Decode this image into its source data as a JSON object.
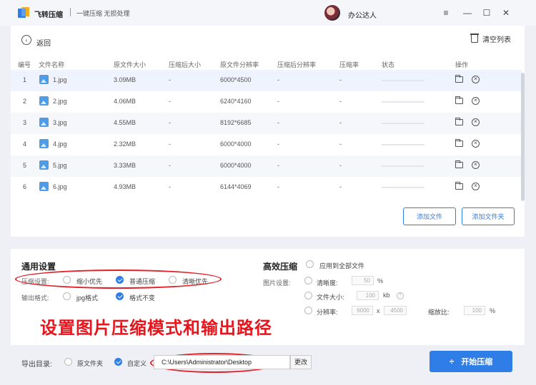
{
  "app": {
    "title": "飞转压缩",
    "subtitle": "一键压缩 无损处理",
    "username": "办公达人",
    "window_controls": [
      "minimize-icon",
      "maximize-icon",
      "close-icon"
    ],
    "accent_color": "#2f7ee8",
    "icon_menu": "≡",
    "icon_min": "—",
    "icon_max": "☐",
    "icon_close": "✕"
  },
  "toolbar": {
    "back_label": "返回",
    "back_icon": "‹",
    "clear_label": "清空列表"
  },
  "table": {
    "headers": [
      "编号",
      "文件名称",
      "原文件大小",
      "压缩后大小",
      "原文件分辨率",
      "压缩后分辨率",
      "压缩率",
      "状态",
      "操作"
    ],
    "rows": [
      {
        "index": "1",
        "name": "1.jpg",
        "size": "3.09MB",
        "compressed_size": "-",
        "resolution": "6000*4500",
        "compressed_resolution": "-",
        "ratio": "-",
        "delete_icon": "×"
      },
      {
        "index": "2",
        "name": "2.jpg",
        "size": "4.06MB",
        "compressed_size": "-",
        "resolution": "6240*4160",
        "compressed_resolution": "-",
        "ratio": "-",
        "delete_icon": "×"
      },
      {
        "index": "3",
        "name": "3.jpg",
        "size": "4.55MB",
        "compressed_size": "-",
        "resolution": "8192*6685",
        "compressed_resolution": "-",
        "ratio": "-",
        "delete_icon": "×"
      },
      {
        "index": "4",
        "name": "4.jpg",
        "size": "2.32MB",
        "compressed_size": "-",
        "resolution": "6000*4000",
        "compressed_resolution": "-",
        "ratio": "-",
        "delete_icon": "×"
      },
      {
        "index": "5",
        "name": "5.jpg",
        "size": "3.33MB",
        "compressed_size": "-",
        "resolution": "6000*4000",
        "compressed_resolution": "-",
        "ratio": "-",
        "delete_icon": "×"
      },
      {
        "index": "6",
        "name": "6.jpg",
        "size": "4.93MB",
        "compressed_size": "-",
        "resolution": "6144*4069",
        "compressed_resolution": "-",
        "ratio": "-",
        "delete_icon": "×"
      }
    ]
  },
  "actions": {
    "add_file": "添加文件",
    "add_folder": "添加文件夹"
  },
  "general_settings": {
    "title": "通用设置",
    "compress_label": "压缩设置:",
    "compress_options": [
      "缩小优先",
      "普通压缩",
      "清晰优先"
    ],
    "compress_selected": "普通压缩",
    "output_label": "输出格式:",
    "output_options": [
      "jpg格式",
      "格式不变"
    ],
    "output_selected": "格式不变"
  },
  "advanced": {
    "title": "高效压缩",
    "apply_all": "应用到全部文件",
    "image_settings_label": "图片设置:",
    "clarity_label": "清晰度:",
    "clarity_value": "50",
    "clarity_unit": "%",
    "filesize_label": "文件大小:",
    "filesize_value": "100",
    "filesize_unit": "kb",
    "info_icon": "?",
    "resolution_label": "分辨率:",
    "res_w": "6000",
    "res_sep": "x",
    "res_h": "4500",
    "scale_label": "缩放比:",
    "scale_value": "100",
    "scale_unit": "%"
  },
  "annotation": "设置图片压缩模式和输出路径",
  "export": {
    "label": "导出目录:",
    "option_original": "原文件夹",
    "option_custom": "自定义",
    "path": "C:\\Users\\Administrator\\Desktop",
    "change_label": "更改"
  },
  "start": {
    "label": "开始压缩",
    "icon": "÷"
  }
}
